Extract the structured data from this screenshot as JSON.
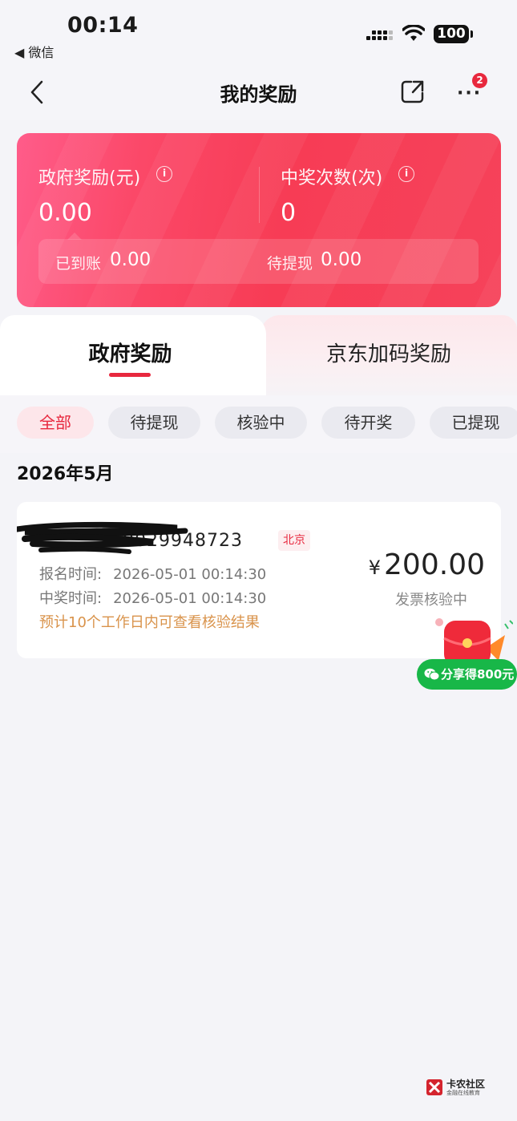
{
  "status_bar": {
    "time": "00:14",
    "back_app": "◀ 微信",
    "battery": "100"
  },
  "nav": {
    "title": "我的奖励",
    "more_badge": "2"
  },
  "summary": {
    "gov_label": "政府奖励(元)",
    "gov_value": "0.00",
    "count_label": "中奖次数(次)",
    "count_value": "0",
    "arrived_label": "已到账",
    "arrived_value": "0.00",
    "pending_label": "待提现",
    "pending_value": "0.00"
  },
  "tabs": [
    {
      "label": "政府奖励",
      "active": true
    },
    {
      "label": "京东加码奖励",
      "active": false
    }
  ],
  "filters": [
    {
      "label": "全部",
      "active": true
    },
    {
      "label": "待提现",
      "active": false
    },
    {
      "label": "核验中",
      "active": false
    },
    {
      "label": "待开奖",
      "active": false
    },
    {
      "label": "已提现",
      "active": false
    }
  ],
  "month": "2026年5月",
  "record": {
    "id": "0029948723",
    "city": "北京",
    "signup_label": "报名时间:",
    "signup_time": "2026-05-01 00:14:30",
    "win_label": "中奖时间:",
    "win_time": "2026-05-01 00:14:30",
    "note": "预计10个工作日内可查看核验结果",
    "currency": "¥",
    "amount": "200.00",
    "status": "发票核验中"
  },
  "share": {
    "label": "分享得800元"
  },
  "watermark": {
    "name": "卡农社区",
    "sub": "金融在线教育"
  },
  "colors": {
    "accent": "#e8283e",
    "card_gradient_start": "#ff5c8a",
    "card_gradient_end": "#f6425a",
    "note": "#d9934b",
    "wechat_green": "#18b748"
  }
}
